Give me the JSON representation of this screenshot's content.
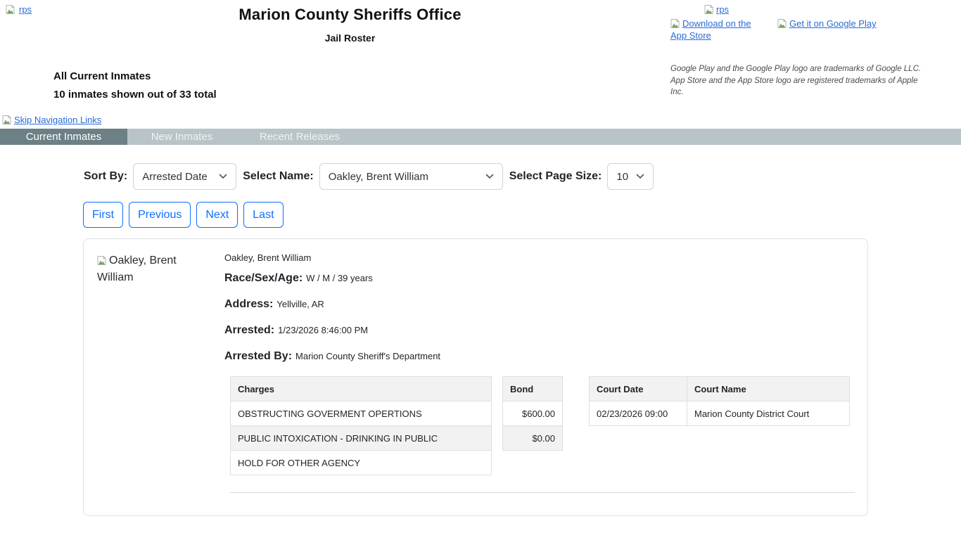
{
  "header": {
    "logo_link_text": "rps",
    "title": "Marion County Sheriffs Office",
    "subtitle": "Jail Roster",
    "roster_title": "All Current Inmates",
    "roster_count": "10 inmates shown out of 33 total",
    "rps_link_text": "rps",
    "app_store_link_text": "Download on the App Store",
    "google_play_link_text": "Get it on Google Play",
    "trademark_line1": "Google Play and the Google Play logo are trademarks of Google LLC.",
    "trademark_line2": "App Store and the App Store logo are registered trademarks of Apple Inc."
  },
  "skip_link_text": "Skip Navigation Links",
  "nav": {
    "tab_current": "Current Inmates",
    "tab_new": "New Inmates",
    "tab_recent": "Recent Releases",
    "active_tab": "Current Inmates",
    "bar_color": "#b8c4c8",
    "active_color": "#6c8086"
  },
  "filters": {
    "sort_by_label": "Sort By:",
    "sort_by_value": "Arrested Date",
    "select_name_label": "Select Name:",
    "select_name_value": "Oakley, Brent William",
    "page_size_label": "Select Page Size:",
    "page_size_value": "10"
  },
  "pagination": {
    "first": "First",
    "previous": "Previous",
    "next": "Next",
    "last": "Last",
    "accent_color": "#0d6efd"
  },
  "inmate": {
    "photo_alt": "Oakley, Brent William",
    "name": "Oakley, Brent William",
    "race_sex_age_label": "Race/Sex/Age:",
    "race_sex_age": "W / M / 39 years",
    "address_label": "Address:",
    "address": "Yellville, AR",
    "arrested_label": "Arrested:",
    "arrested": "1/23/2026 8:46:00 PM",
    "arrested_by_label": "Arrested By:",
    "arrested_by": "Marion County Sheriff's Department",
    "charges_table": {
      "header": "Charges",
      "rows": [
        "OBSTRUCTING GOVERMENT OPERTIONS",
        "PUBLIC INTOXICATION - DRINKING IN PUBLIC",
        "HOLD FOR OTHER AGENCY"
      ]
    },
    "bond_table": {
      "header": "Bond",
      "rows": [
        "$600.00",
        "$0.00"
      ]
    },
    "court_table": {
      "header_date": "Court Date",
      "header_name": "Court Name",
      "rows": [
        {
          "date": "02/23/2026 09:00",
          "name": "Marion County District Court"
        }
      ]
    }
  },
  "colors": {
    "link_blue": "#2a6bd4",
    "table_header_bg": "#f2f2f2",
    "card_border": "#dee2e6"
  }
}
